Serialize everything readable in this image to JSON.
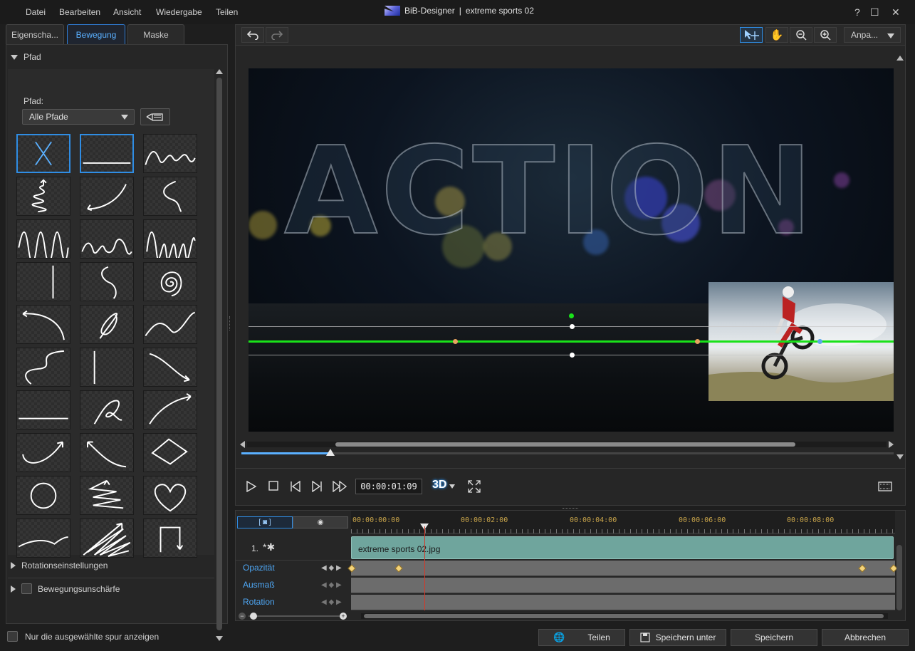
{
  "menu": {
    "datei": "Datei",
    "bearbeiten": "Bearbeiten",
    "ansicht": "Ansicht",
    "wiedergabe": "Wiedergabe",
    "teilen": "Teilen"
  },
  "title": {
    "app": "BiB-Designer",
    "separator": "|",
    "project": "extreme sports 02"
  },
  "window": {
    "help": "?",
    "maximize": "☐",
    "close": "✕"
  },
  "tabs": {
    "properties": "Eigenscha...",
    "motion": "Bewegung",
    "mask": "Maske"
  },
  "pfad_section": {
    "header": "Pfad",
    "label": "Pfad:",
    "dropdown_value": "Alle Pfade"
  },
  "path_presets": [
    "none",
    "horizontal-line",
    "sine-wave",
    "zigzag-down",
    "curve-up",
    "s-curve",
    "wave-large",
    "wave-small",
    "wave-large-2",
    "vertical-line",
    "s-small",
    "spiral",
    "arc-left",
    "loop",
    "wave-right",
    "s-big",
    "vertical-line-2",
    "curve-down",
    "line-horizontal-2",
    "curl",
    "arc-right",
    "curve-up-right",
    "curve-up-left",
    "diamond",
    "circle",
    "zigzag-stack",
    "heart",
    "swoosh",
    "scribble",
    "rectangle-open"
  ],
  "sections": {
    "rotation": "Rotationseinstellungen",
    "motion_blur": "Bewegungsunschärfe"
  },
  "bottom_left": {
    "only_selected": "Nur die ausgewählte spur anzeigen"
  },
  "toolbar": {
    "fit": "Anpa..."
  },
  "preview": {
    "overlay_text": "ACTION",
    "seek_progress": 0.135
  },
  "playback": {
    "timecode": "00:00:01:09",
    "three_d": "3D"
  },
  "timeline": {
    "ruler": [
      "00:00:00:00",
      "00:00:02:00",
      "00:00:04:00",
      "00:00:06:00",
      "00:00:08:00"
    ],
    "track_number": "1.",
    "clip_name": "extreme sports 02.jpg",
    "tracks": [
      "Opazität",
      "Ausmaß",
      "Rotation"
    ]
  },
  "buttons": {
    "share": "Teilen",
    "save_as": "Speichern unter",
    "save": "Speichern",
    "cancel": "Abbrechen"
  },
  "colors": {
    "accent": "#2f8de4",
    "path_green": "#19e219",
    "keyframe": "#f3d37a",
    "clip": "#6fa59d",
    "playhead": "#d23a2a"
  }
}
